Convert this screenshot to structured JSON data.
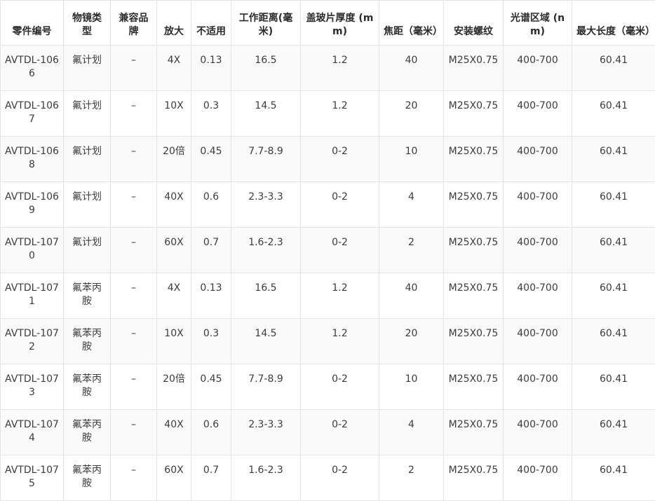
{
  "table": {
    "headers": [
      "零件编号",
      "物镜类型",
      "兼容品牌",
      "放大",
      "不适用",
      "工作距离(毫米)",
      "盖玻片厚度 (mm)",
      "焦距（毫米）",
      "安装螺纹",
      "光谱区域 (nm)",
      "最大长度（毫米）"
    ],
    "rows": [
      [
        "AVTDL-1066",
        "氟计划",
        "–",
        "4X",
        "0.13",
        "16.5",
        "1.2",
        "40",
        "M25X0.75",
        "400-700",
        "60.41"
      ],
      [
        "AVTDL-1067",
        "氟计划",
        "–",
        "10X",
        "0.3",
        "14.5",
        "1.2",
        "20",
        "M25X0.75",
        "400-700",
        "60.41"
      ],
      [
        "AVTDL-1068",
        "氟计划",
        "–",
        "20倍",
        "0.45",
        "7.7-8.9",
        "0-2",
        "10",
        "M25X0.75",
        "400-700",
        "60.41"
      ],
      [
        "AVTDL-1069",
        "氟计划",
        "–",
        "40X",
        "0.6",
        "2.3-3.3",
        "0-2",
        "4",
        "M25X0.75",
        "400-700",
        "60.41"
      ],
      [
        "AVTDL-1070",
        "氟计划",
        "–",
        "60X",
        "0.7",
        "1.6-2.3",
        "0-2",
        "2",
        "M25X0.75",
        "400-700",
        "60.41"
      ],
      [
        "AVTDL-1071",
        "氟苯丙胺",
        "–",
        "4X",
        "0.13",
        "16.5",
        "1.2",
        "40",
        "M25X0.75",
        "400-700",
        "60.41"
      ],
      [
        "AVTDL-1072",
        "氟苯丙胺",
        "–",
        "10X",
        "0.3",
        "14.5",
        "1.2",
        "20",
        "M25X0.75",
        "400-700",
        "60.41"
      ],
      [
        "AVTDL-1073",
        "氟苯丙胺",
        "–",
        "20倍",
        "0.45",
        "7.7-8.9",
        "0-2",
        "10",
        "M25X0.75",
        "400-700",
        "60.41"
      ],
      [
        "AVTDL-1074",
        "氟苯丙胺",
        "–",
        "40X",
        "0.6",
        "2.3-3.3",
        "0-2",
        "4",
        "M25X0.75",
        "400-700",
        "60.41"
      ],
      [
        "AVTDL-1075",
        "氟苯丙胺",
        "–",
        "60X",
        "0.7",
        "1.6-2.3",
        "0-2",
        "2",
        "M25X0.75",
        "400-700",
        "60.41"
      ]
    ]
  }
}
